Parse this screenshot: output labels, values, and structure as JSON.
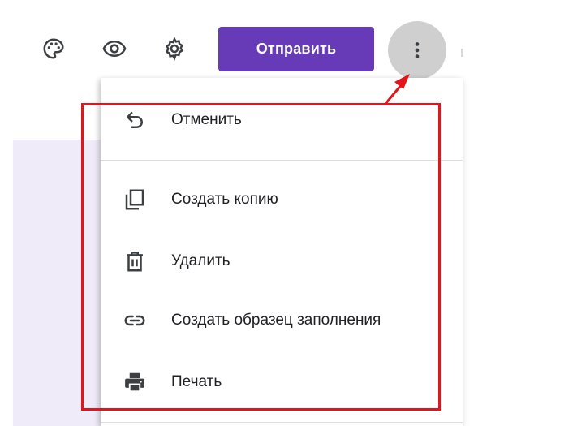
{
  "toolbar": {
    "palette_icon": "palette-icon",
    "preview_icon": "eye-icon",
    "settings_icon": "gear-icon",
    "send_label": "Отправить",
    "more_icon": "more-vert-icon"
  },
  "menu": {
    "items": [
      {
        "label": "Отменить",
        "icon": "undo-icon"
      },
      {
        "label": "Создать копию",
        "icon": "copy-icon"
      },
      {
        "label": "Удалить",
        "icon": "trash-icon"
      },
      {
        "label": "Создать образец заполнения",
        "icon": "link-icon"
      },
      {
        "label": "Печать",
        "icon": "printer-icon"
      }
    ]
  },
  "colors": {
    "accent": "#673ab7",
    "highlight": "#e4141b",
    "more_button_bg": "#cfcfcf",
    "page_bg": "#f0ebf8",
    "icon": "#3c4043"
  }
}
